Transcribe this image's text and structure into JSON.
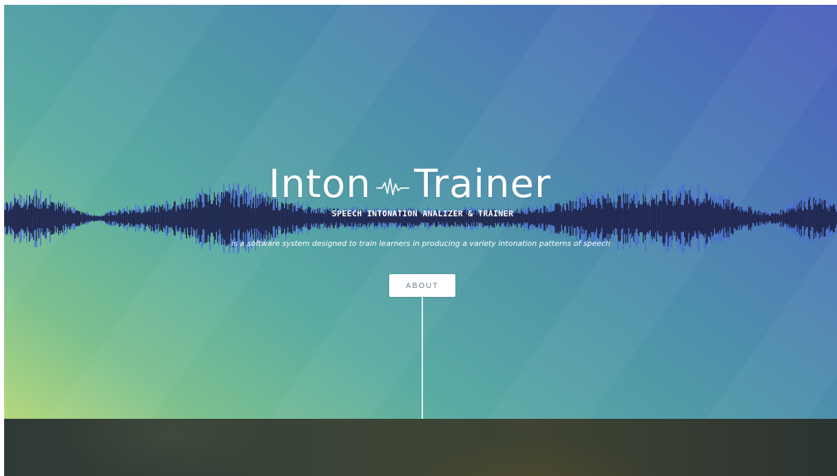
{
  "hero": {
    "logo_left": "Inton",
    "logo_right": "Trainer",
    "tagline": "SPEECH INTONATION ANALIZER & TRAINER",
    "description": "is a software system designed to train learners in producing a variety intonation patterns of speech",
    "about_button_label": "ABOUT",
    "pulse_icon": "waveform-pulse-icon"
  },
  "colors": {
    "gradient_start": "#b4d87e",
    "gradient_mid": "#5aaca3",
    "gradient_end": "#4b5fbd",
    "waveform_dark": "#1c1f3f",
    "waveform_blue": "#4a6fd1",
    "footer": "#333c37"
  }
}
